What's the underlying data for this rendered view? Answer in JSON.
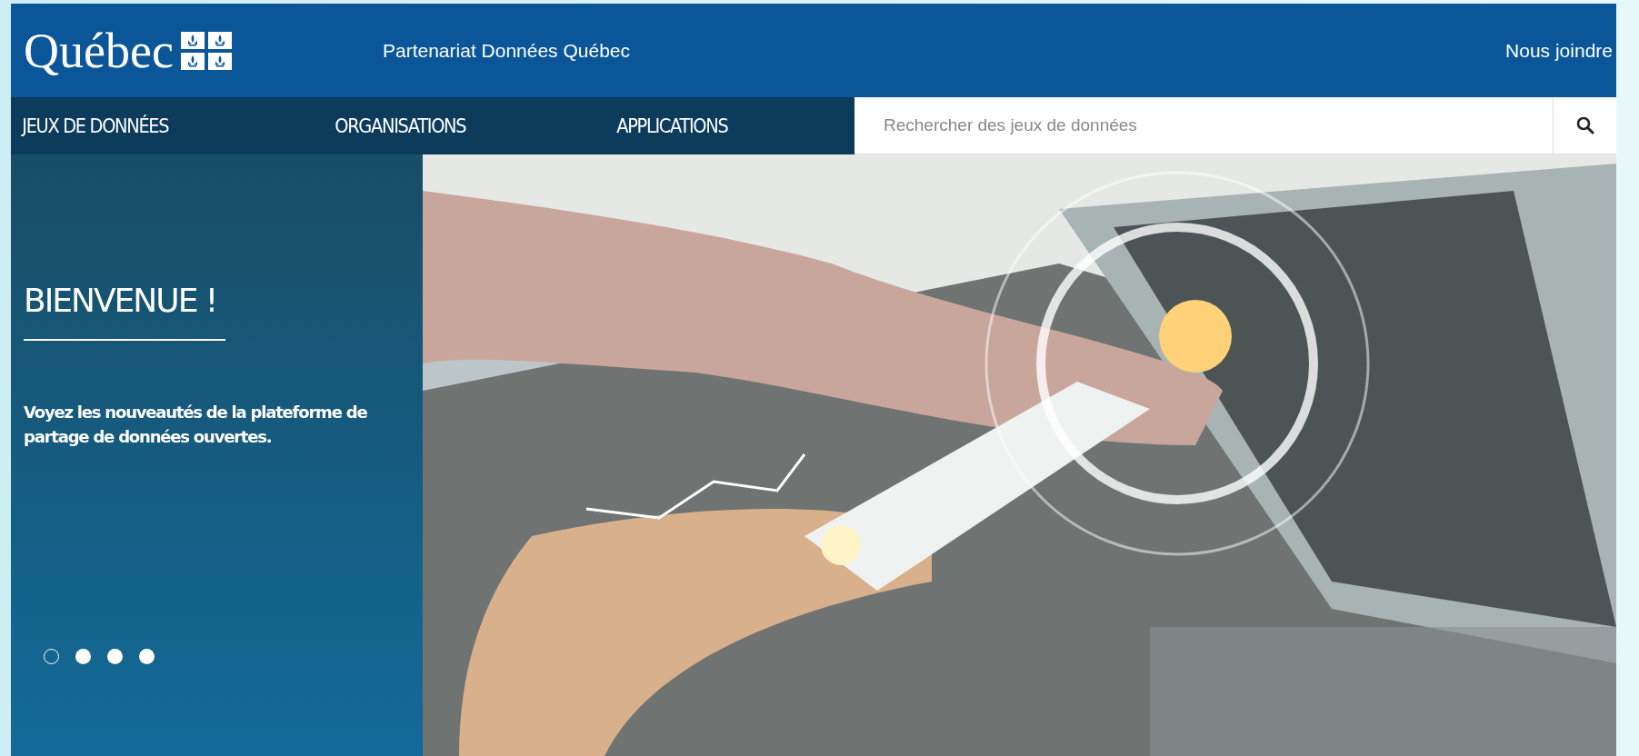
{
  "header": {
    "logo": "Québec",
    "site_name": "Partenariat Données Québec",
    "contact_link": "Nous joindre"
  },
  "nav": {
    "items": [
      {
        "label": "JEUX DE DONNÉES"
      },
      {
        "label": "ORGANISATIONS"
      },
      {
        "label": "APPLICATIONS"
      }
    ],
    "search": {
      "placeholder": "Rechercher des jeux de données"
    }
  },
  "hero": {
    "title": "BIENVENUE !",
    "text": "Voyez les nouveautés de la plateforme de partage de données ouvertes.",
    "dots": [
      {
        "selected": true
      },
      {
        "selected": false
      },
      {
        "selected": false
      },
      {
        "selected": false
      }
    ]
  }
}
